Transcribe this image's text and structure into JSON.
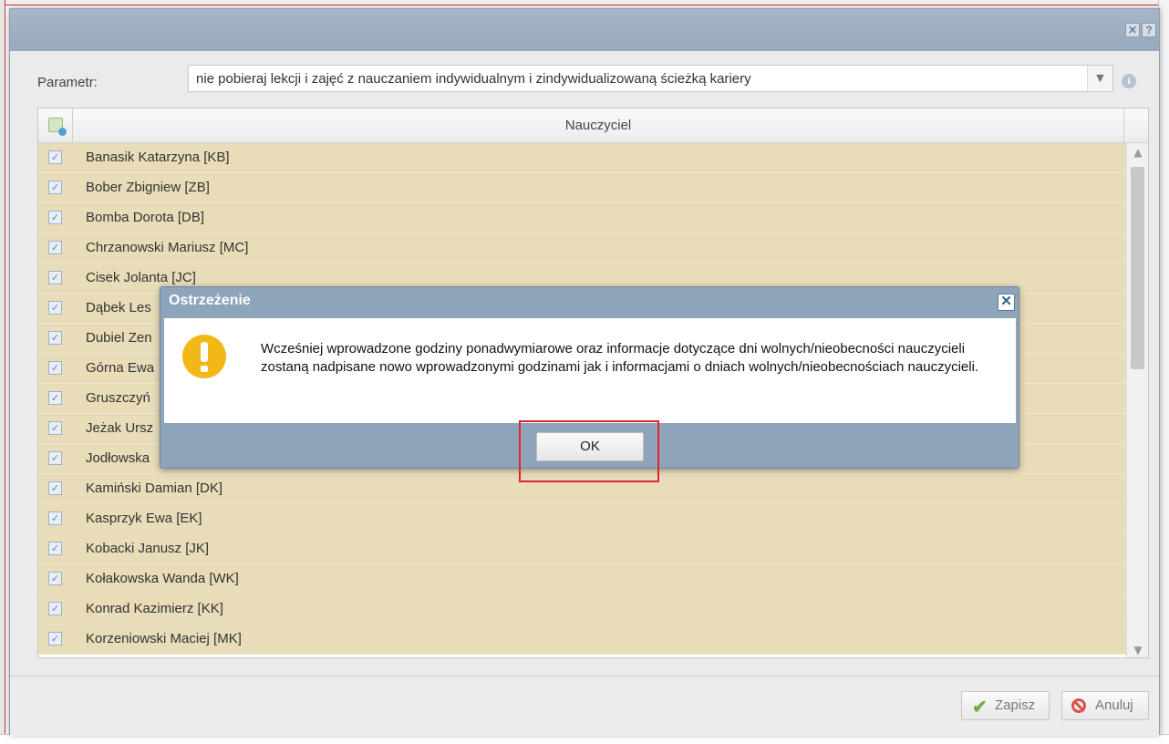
{
  "window": {
    "close_glyph": "✕",
    "help_glyph": "?"
  },
  "parameter": {
    "label": "Parametr:",
    "value": "nie pobieraj lekcji i zajęć z nauczaniem indywidualnym i zindywidualizowaną ścieżką kariery",
    "info_icon": "info-icon"
  },
  "grid": {
    "column_header": "Nauczyciel",
    "rows": [
      "Banasik Katarzyna [KB]",
      "Bober Zbigniew [ZB]",
      "Bomba Dorota [DB]",
      "Chrzanowski Mariusz [MC]",
      "Cisek Jolanta [JC]",
      "Dąbek Les",
      "Dubiel Zen",
      "Górna Ewa",
      "Gruszczyń",
      "Jeżak Ursz",
      "Jodłowska",
      "Kamiński Damian [DK]",
      "Kasprzyk Ewa [EK]",
      "Kobacki Janusz [JK]",
      "Kołakowska Wanda [WK]",
      "Konrad Kazimierz [KK]",
      "Korzeniowski Maciej [MK]"
    ]
  },
  "footer": {
    "save_label": "Zapisz",
    "cancel_label": "Anuluj"
  },
  "dialog": {
    "title": "Ostrzeżenie",
    "message": "Wcześniej wprowadzone godziny ponadwymiarowe oraz informacje dotyczące dni wolnych/nieobecności nauczycieli zostaną nadpisane nowo wprowadzonymi godzinami jak i informacjami o dniach wolnych/nieobecnościach nauczycieli.",
    "ok_label": "OK"
  },
  "colors": {
    "row_background": "#e8dcb9",
    "header_gradient": "#a7b7c9",
    "dialog_frame": "#8da4bb",
    "warning_icon": "#f2b817",
    "highlight_box": "#e0242c"
  }
}
